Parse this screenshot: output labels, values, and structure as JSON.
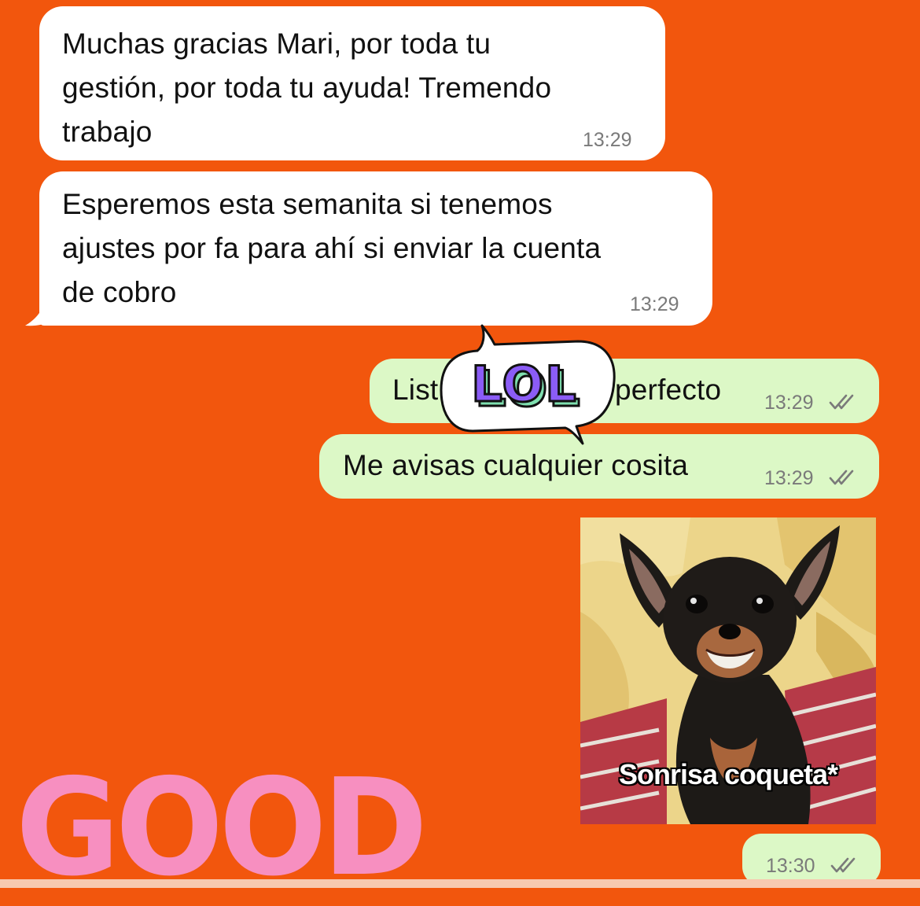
{
  "messages": [
    {
      "direction": "incoming",
      "lines": [
        "Muchas gracias Mari, por toda tu",
        "gestión, por toda tu ayuda! Tremendo",
        "trabajo"
      ],
      "time": "13:29"
    },
    {
      "direction": "incoming",
      "lines": [
        "Esperemos esta semanita si tenemos",
        "ajustes por fa para ahí si enviar la cuenta",
        "de cobro"
      ],
      "time": "13:29"
    },
    {
      "direction": "outgoing",
      "text_left": "List",
      "text_right": "perfecto",
      "time": "13:29",
      "status": "read-double-check"
    },
    {
      "direction": "outgoing",
      "text": "Me avisas cualquier cosita",
      "time": "13:29",
      "status": "read-double-check"
    },
    {
      "direction": "outgoing",
      "type": "image",
      "caption": "Sonrisa coqueta*",
      "time": "13:30",
      "status": "read-double-check"
    }
  ],
  "stickers": {
    "lol": "LOL",
    "good": "GOOD"
  },
  "icons": {
    "ticks": "double-check-icon"
  },
  "colors": {
    "background": "#f2560d",
    "incoming_bubble": "#ffffff",
    "outgoing_bubble": "#dcf8c6",
    "timestamp": "#7a7a7a",
    "good_sticker": "#f78fc0",
    "lol_sticker": "#8b5cf6"
  }
}
